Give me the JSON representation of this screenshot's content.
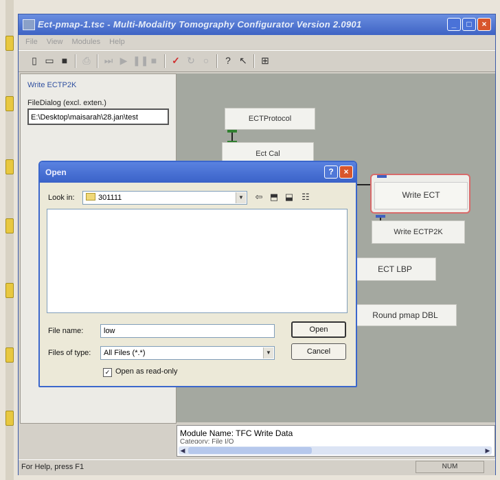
{
  "window": {
    "title": "Ect-pmap-1.tsc - Multi-Modality Tomography Configurator Version 2.0901"
  },
  "menu": [
    "File",
    "View",
    "Modules",
    "Help"
  ],
  "left_panel": {
    "title": "Write ECTP2K",
    "field_label": "FileDialog (excl. exten.)",
    "field_value": "E:\\Desktop\\maisarah\\28.jan\\test"
  },
  "canvas": {
    "modules": {
      "ect_protocol": "ECTProtocol",
      "ect_cal": "Ect Cal",
      "write_ect": "Write ECT",
      "write_ectp2k": "Write ECTP2K",
      "ect_lbp": "ECT LBP",
      "round_pmap": "Round pmap DBL"
    }
  },
  "info": {
    "module_name": "Module Name: TFC Write Data",
    "category": "Category: File I/O"
  },
  "status": {
    "help": "For Help, press F1",
    "num": "NUM"
  },
  "open_dialog": {
    "title": "Open",
    "look_in_label": "Look in:",
    "look_in_value": "301111",
    "file_name_label": "File name:",
    "file_name_value": "low",
    "files_of_type_label": "Files of type:",
    "files_of_type_value": "All Files (*.*)",
    "open_button": "Open",
    "cancel_button": "Cancel",
    "read_only_label": "Open as read-only",
    "read_only_checked": true
  }
}
